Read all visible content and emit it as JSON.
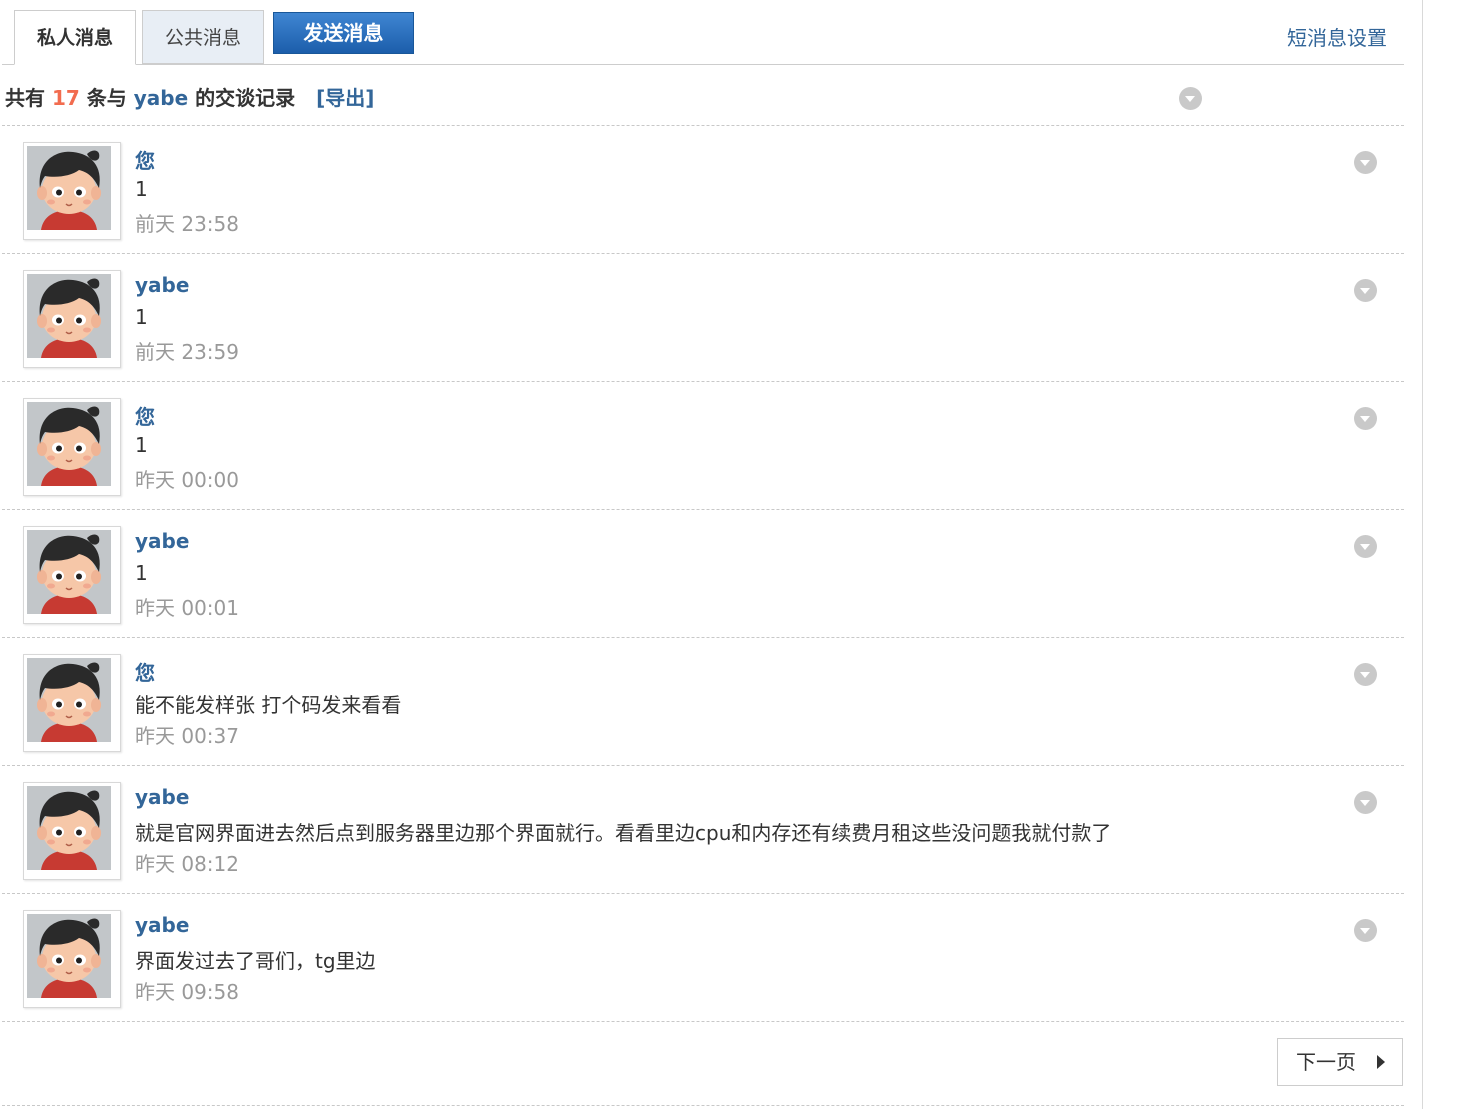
{
  "tabs": {
    "private": "私人消息",
    "public": "公共消息",
    "send": "发送消息",
    "settings": "短消息设置"
  },
  "summary": {
    "prefix": "共有",
    "count": "17",
    "middle": "条与",
    "user": "yabe",
    "suffix": "的交谈记录",
    "export": "[导出]"
  },
  "messages": [
    {
      "author": "您",
      "text": "1",
      "time": "前天 23:58"
    },
    {
      "author": "yabe",
      "text": "1",
      "time": "前天 23:59"
    },
    {
      "author": "您",
      "text": "1",
      "time": "昨天 00:00"
    },
    {
      "author": "yabe",
      "text": "1",
      "time": "昨天 00:01"
    },
    {
      "author": "您",
      "text": "能不能发样张  打个码发来看看",
      "time": "昨天 00:37"
    },
    {
      "author": "yabe",
      "text": "就是官网界面进去然后点到服务器里边那个界面就行。看看里边cpu和内存还有续费月租这些没问题我就付款了",
      "time": "昨天 08:12"
    },
    {
      "author": "yabe",
      "text": "界面发过去了哥们，tg里边",
      "time": "昨天 09:58"
    }
  ],
  "pager": {
    "next": "下一页"
  }
}
